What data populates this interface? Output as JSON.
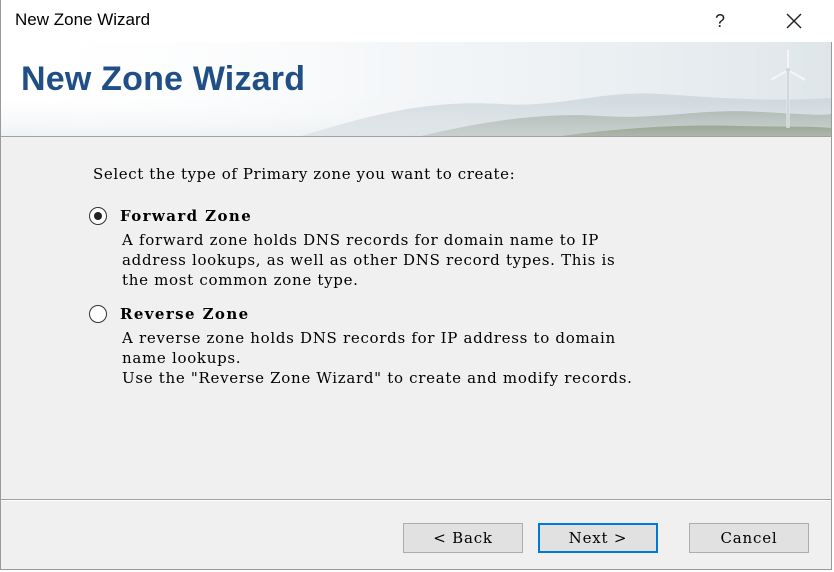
{
  "window": {
    "title": "New Zone Wizard",
    "help_label": "?"
  },
  "banner": {
    "title": "New Zone Wizard"
  },
  "body": {
    "prompt": "Select the type of Primary zone you want to create:",
    "options": [
      {
        "label": "Forward Zone",
        "selected": true,
        "description": [
          "A forward zone holds DNS records for domain name to IP",
          "address lookups, as well as other DNS record types. This is",
          "the most common zone type."
        ]
      },
      {
        "label": "Reverse Zone",
        "selected": false,
        "description": [
          "A reverse zone holds DNS records for IP address to domain",
          "name lookups.",
          "Use the \"Reverse Zone Wizard\" to create and modify records."
        ]
      }
    ]
  },
  "footer": {
    "back_label": "< Back",
    "next_label": "Next >",
    "cancel_label": "Cancel"
  },
  "colors": {
    "banner_title": "#1f4f86",
    "default_button_border": "#0078d7",
    "dialog_background": "#f0f0f0"
  },
  "icons": {
    "close": "close-icon",
    "help": "help-icon",
    "wind_turbine": "wind-turbine-icon"
  }
}
